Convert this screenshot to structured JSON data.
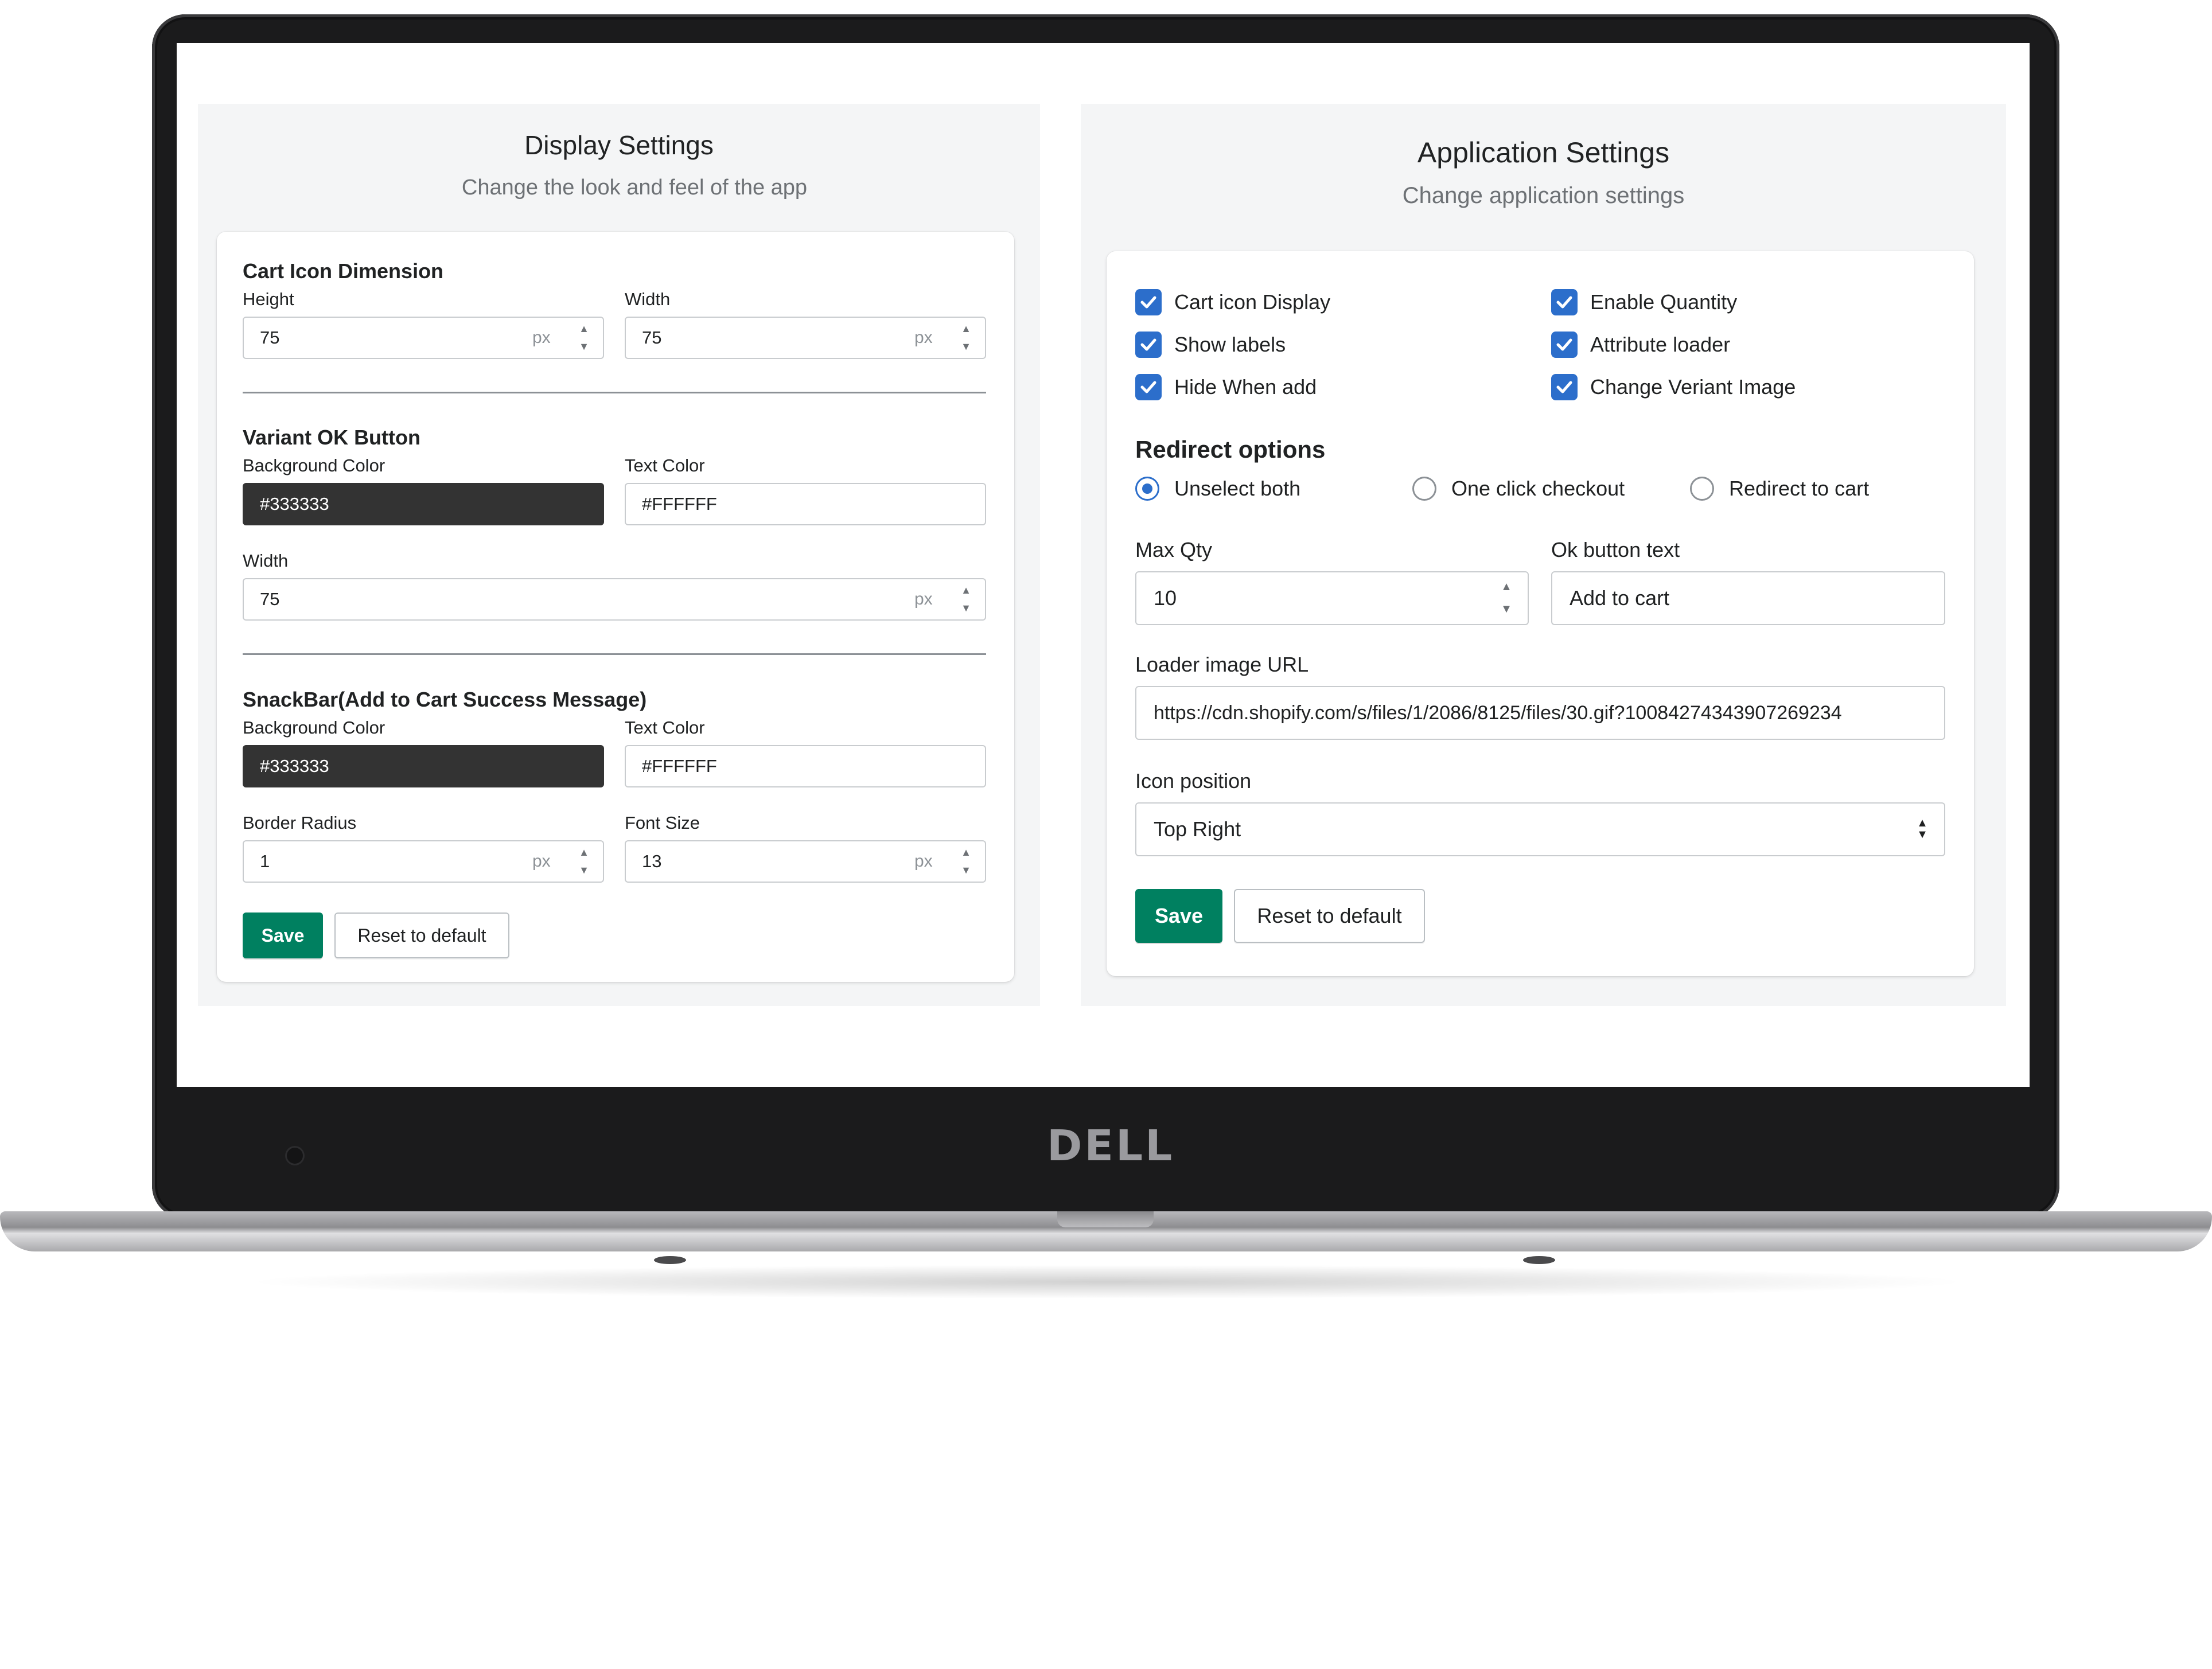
{
  "device": {
    "brand_logo": "DELL"
  },
  "display_settings": {
    "title": "Display Settings",
    "subtitle": "Change the look and feel of the app",
    "cart_icon": {
      "heading": "Cart Icon Dimension",
      "height_label": "Height",
      "height_value": "75",
      "width_label": "Width",
      "width_value": "75",
      "unit": "px"
    },
    "variant_ok": {
      "heading": "Variant OK Button",
      "bg_label": "Background Color",
      "bg_value": "#333333",
      "text_color_label": "Text Color",
      "text_color_value": "#FFFFFF",
      "width_label": "Width",
      "width_value": "75",
      "unit": "px"
    },
    "snackbar": {
      "heading": "SnackBar(Add to Cart Success Message)",
      "bg_label": "Background Color",
      "bg_value": "#333333",
      "text_color_label": "Text Color",
      "text_color_value": "#FFFFFF",
      "radius_label": "Border Radius",
      "radius_value": "1",
      "font_size_label": "Font Size",
      "font_size_value": "13",
      "unit": "px"
    },
    "save_label": "Save",
    "reset_label": "Reset to default"
  },
  "application_settings": {
    "title": "Application Settings",
    "subtitle": "Change application settings",
    "checkboxes": [
      {
        "label": "Cart icon Display",
        "checked": true
      },
      {
        "label": "Show labels",
        "checked": true
      },
      {
        "label": "Hide When add",
        "checked": true
      },
      {
        "label": "Enable Quantity",
        "checked": true
      },
      {
        "label": "Attribute loader",
        "checked": true
      },
      {
        "label": "Change Veriant Image",
        "checked": true
      }
    ],
    "redirect": {
      "heading": "Redirect options",
      "options": [
        {
          "label": "Unselect both",
          "selected": true
        },
        {
          "label": "One click checkout",
          "selected": false
        },
        {
          "label": "Redirect to cart",
          "selected": false
        }
      ]
    },
    "max_qty_label": "Max Qty",
    "max_qty_value": "10",
    "ok_text_label": "Ok button text",
    "ok_text_value": "Add to cart",
    "loader_label": "Loader image URL",
    "loader_value": "https://cdn.shopify.com/s/files/1/2086/8125/files/30.gif?10084274343907269234",
    "icon_position_label": "Icon position",
    "icon_position_value": "Top Right",
    "save_label": "Save",
    "reset_label": "Reset to default"
  },
  "colors": {
    "primary_button": "#008060",
    "checkbox_accent": "#2c6ecb",
    "dark_swatch": "#333333"
  }
}
